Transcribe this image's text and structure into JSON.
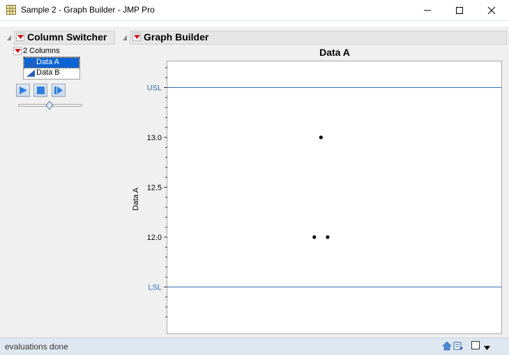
{
  "window": {
    "title": "Sample 2 - Graph Builder - JMP Pro"
  },
  "column_switcher": {
    "title": "Column Switcher",
    "columns_label": "2 Columns",
    "columns": [
      {
        "label": "Data A",
        "selected": true
      },
      {
        "label": "Data B",
        "selected": false
      }
    ],
    "slider_value": 0.5
  },
  "graph_builder": {
    "title": "Graph Builder"
  },
  "chart_data": {
    "type": "scatter",
    "title": "Data A",
    "xlabel": "",
    "ylabel": "Data A",
    "ylim": [
      11.5,
      13.5
    ],
    "y_ticks": [
      "12.0",
      "12.5",
      "13.0"
    ],
    "reference_lines": [
      {
        "label": "USL",
        "value": 13.5
      },
      {
        "label": "LSL",
        "value": 11.5
      }
    ],
    "points": [
      {
        "x": 0.46,
        "y": 13.0
      },
      {
        "x": 0.44,
        "y": 12.0
      },
      {
        "x": 0.48,
        "y": 12.0
      }
    ],
    "ref_color": "#2f6fb8"
  },
  "status": {
    "text": "evaluations done"
  }
}
